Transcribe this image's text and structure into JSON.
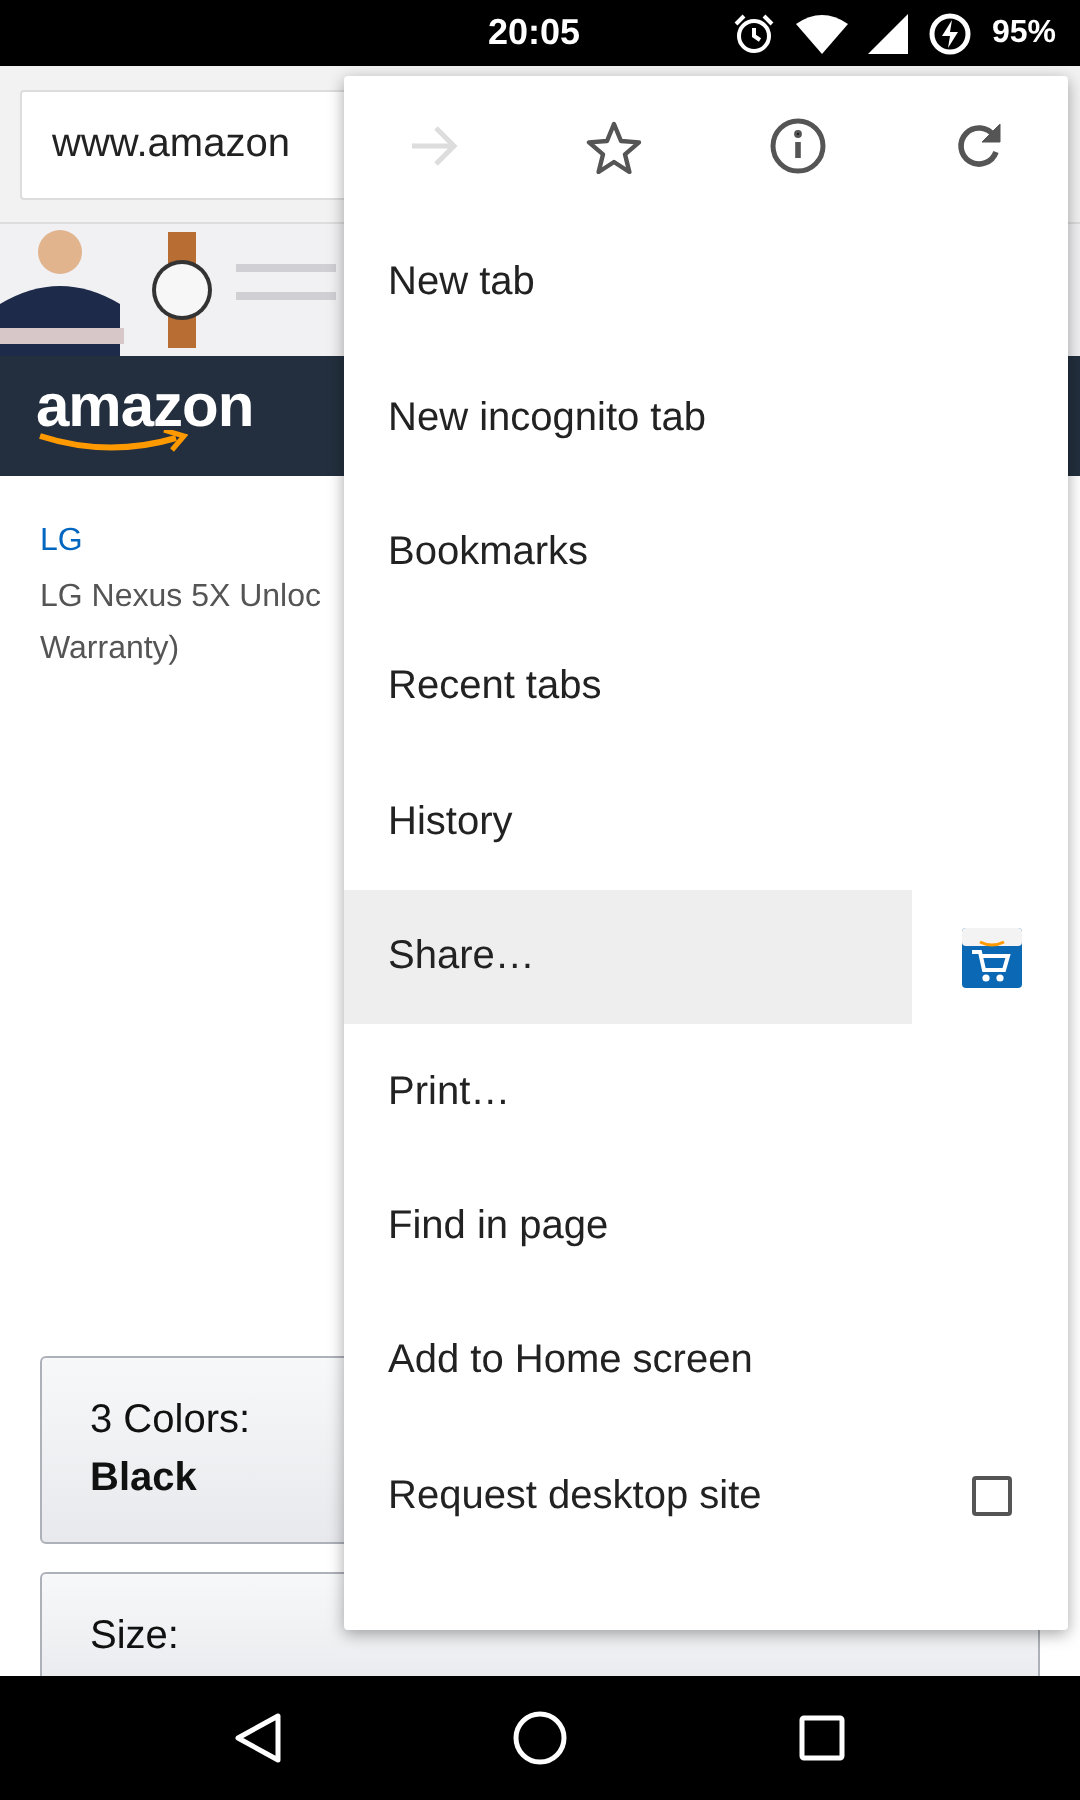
{
  "status_bar": {
    "time": "20:05",
    "battery": "95%"
  },
  "toolbar": {
    "url": "www.amazon"
  },
  "page": {
    "logo": "amazon",
    "brand": "LG",
    "title_lines": [
      "LG Nexus 5X Unloc",
      "Warranty)"
    ],
    "options": [
      {
        "label": "3 Colors:",
        "value": "Black"
      },
      {
        "label": "Size:"
      }
    ]
  },
  "menu": {
    "icon_row": [
      {
        "kind": "forward",
        "disabled": true
      },
      {
        "kind": "star",
        "disabled": false
      },
      {
        "kind": "info",
        "disabled": false
      },
      {
        "kind": "reload",
        "disabled": false
      }
    ],
    "items": [
      {
        "label": "New tab",
        "kind": "plain",
        "selected": false
      },
      {
        "label": "New incognito tab",
        "kind": "plain",
        "selected": false
      },
      {
        "label": "Bookmarks",
        "kind": "plain",
        "selected": false
      },
      {
        "label": "Recent tabs",
        "kind": "plain",
        "selected": false
      },
      {
        "label": "History",
        "kind": "plain",
        "selected": false
      },
      {
        "label": "Share…",
        "kind": "share",
        "selected": true
      },
      {
        "label": "Print…",
        "kind": "plain",
        "selected": false
      },
      {
        "label": "Find in page",
        "kind": "plain",
        "selected": false
      },
      {
        "label": "Add to Home screen",
        "kind": "plain",
        "selected": false
      },
      {
        "label": "Request desktop site",
        "kind": "checkbox",
        "selected": false,
        "checked": false
      }
    ]
  }
}
